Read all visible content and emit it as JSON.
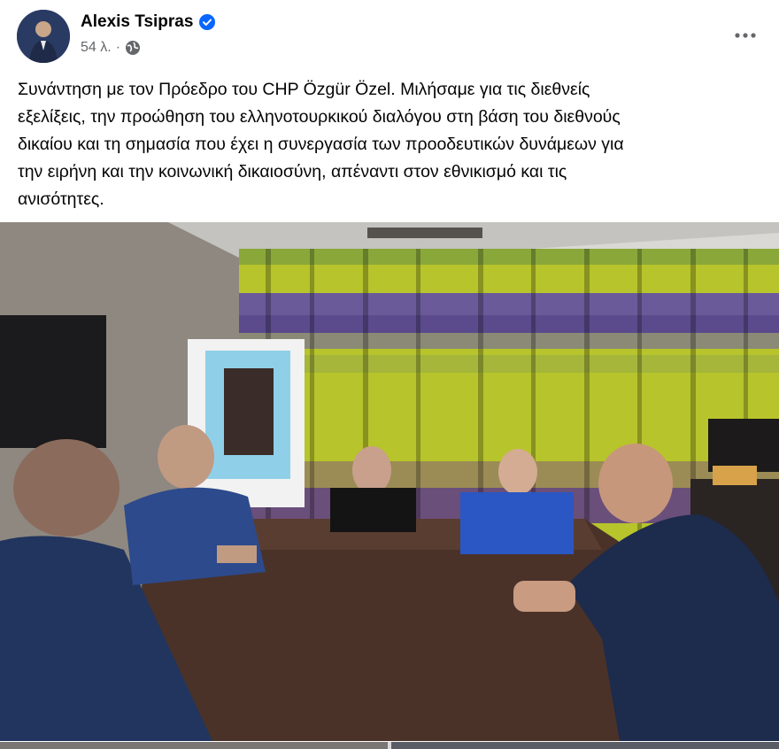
{
  "post": {
    "author": "Alexis Tsipras",
    "time": "54 λ.",
    "separator": "·",
    "privacy_icon": "globe-icon",
    "verified_icon": "verified-badge-icon",
    "more_icon": "more-dots-icon",
    "text": "Συνάντηση με τον Πρόεδρο του CHP Özgür Özel. Μιλήσαμε για τις διεθνείς\nεξελίξεις, την προώθηση του ελληνοτουρκικού διαλόγου στη βάση του διεθνούς\nδικαίου και τη σημασία που έχει η συνεργασία των προοδευτικών δυνάμεων για\nτην ειρήνη και την κοινωνική δικαιοσύνη, απέναντι στον εθνικισμό και τις\nανισότητες."
  },
  "colors": {
    "verified_blue": "#0866ff",
    "meta_gray": "#65676b",
    "text_black": "#050505"
  }
}
